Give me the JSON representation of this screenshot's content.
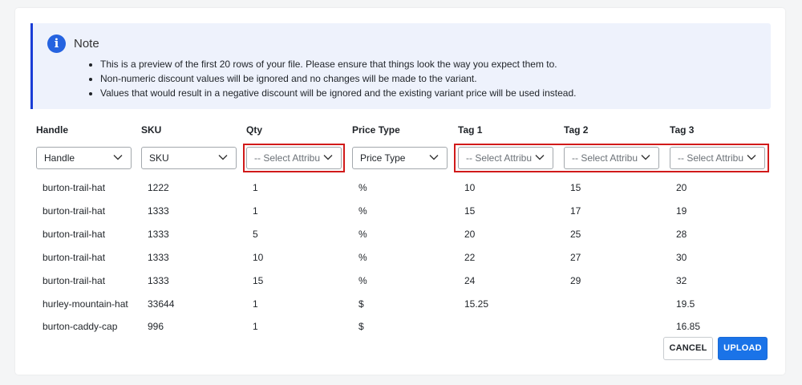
{
  "note": {
    "icon": "info-icon",
    "icon_glyph": "i",
    "title": "Note",
    "items": [
      "This is a preview of the first 20 rows of your file. Please ensure that things look the way you expect them to.",
      "Non-numeric discount values will be ignored and no changes will be made to the variant.",
      "Values that would result in a negative discount will be ignored and the existing variant price will be used instead."
    ]
  },
  "columns": [
    {
      "key": "handle",
      "header": "Handle",
      "select": "Handle",
      "placeholder": false
    },
    {
      "key": "sku",
      "header": "SKU",
      "select": "SKU",
      "placeholder": false
    },
    {
      "key": "qty",
      "header": "Qty",
      "select": "-- Select Attribute --",
      "placeholder": true
    },
    {
      "key": "price_type",
      "header": "Price Type",
      "select": "Price Type",
      "placeholder": false
    },
    {
      "key": "tag1",
      "header": "Tag 1",
      "select": "-- Select Attribute --",
      "placeholder": true
    },
    {
      "key": "tag2",
      "header": "Tag 2",
      "select": "-- Select Attribute --",
      "placeholder": true
    },
    {
      "key": "tag3",
      "header": "Tag 3",
      "select": "-- Select Attribute --",
      "placeholder": true
    }
  ],
  "rows": [
    [
      "burton-trail-hat",
      "1222",
      "1",
      "%",
      "10",
      "15",
      "20"
    ],
    [
      "burton-trail-hat",
      "1333",
      "1",
      "%",
      "15",
      "17",
      "19"
    ],
    [
      "burton-trail-hat",
      "1333",
      "5",
      "%",
      "20",
      "25",
      "28"
    ],
    [
      "burton-trail-hat",
      "1333",
      "10",
      "%",
      "22",
      "27",
      "30"
    ],
    [
      "burton-trail-hat",
      "1333",
      "15",
      "%",
      "24",
      "29",
      "32"
    ],
    [
      "hurley-mountain-hat",
      "33644",
      "1",
      "$",
      "15.25",
      "",
      "19.5"
    ],
    [
      "burton-caddy-cap",
      "996",
      "1",
      "$",
      "",
      "",
      "16.85"
    ]
  ],
  "buttons": {
    "cancel": "CANCEL",
    "upload": "UPLOAD"
  },
  "colors": {
    "accent": "#1a73e8",
    "note_background": "#eef2fc",
    "note_border": "#1a3dd6",
    "highlight": "#d11a1a"
  }
}
